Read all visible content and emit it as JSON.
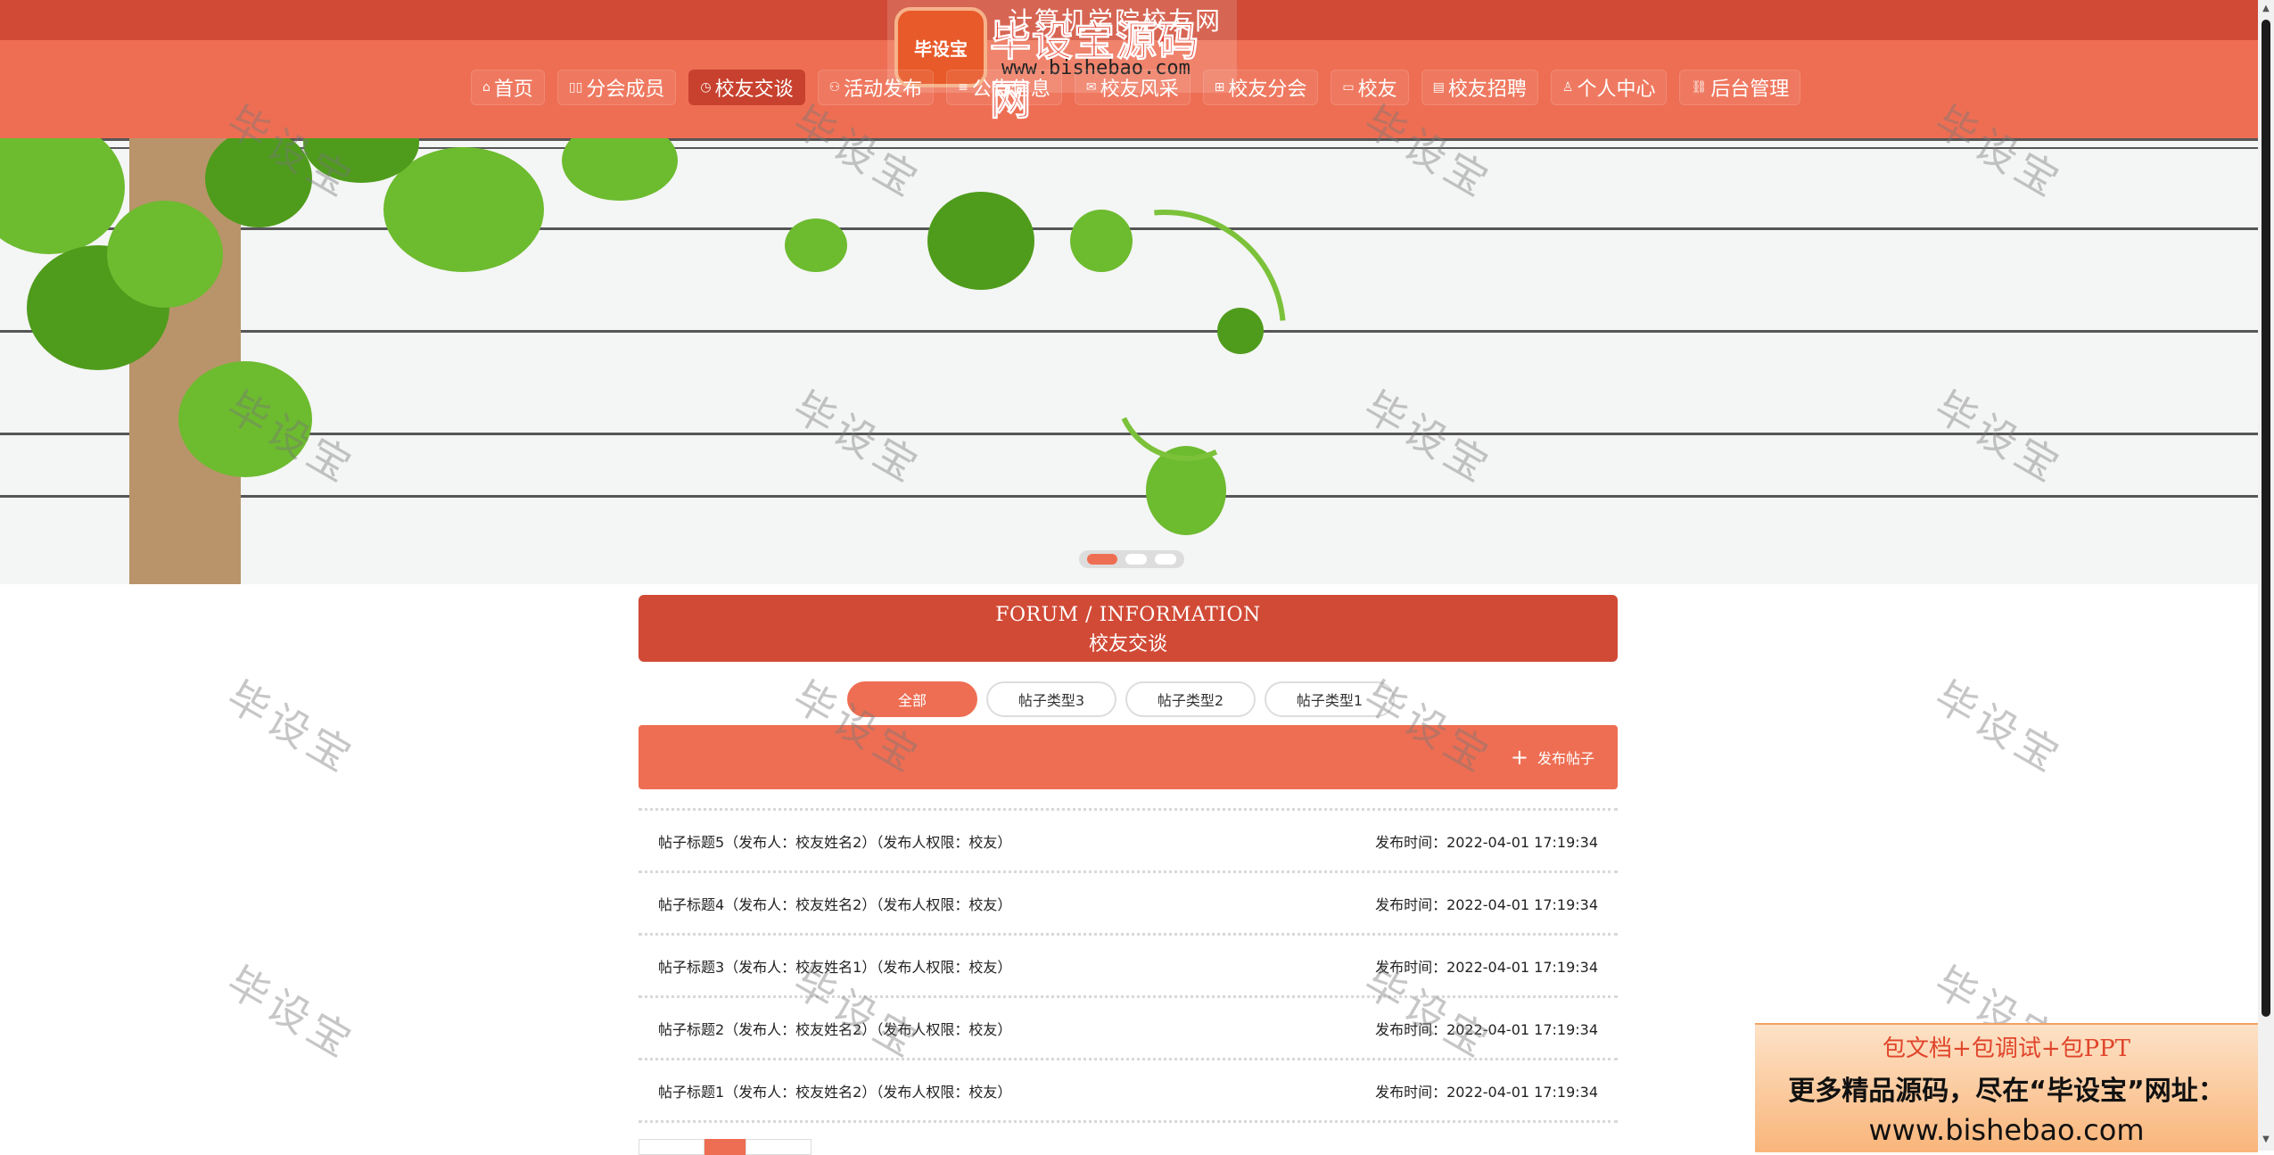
{
  "site": {
    "title": "计算机学院校友网"
  },
  "logo": {
    "badge": "毕设宝",
    "name": "毕设宝源码网",
    "url": "www.bishebao.com"
  },
  "nav": [
    {
      "label": "首页",
      "icon": "home-icon",
      "glyph": "⌂"
    },
    {
      "label": "分会成员",
      "icon": "members-icon",
      "glyph": "▯▯"
    },
    {
      "label": "校友交谈",
      "icon": "clock-icon",
      "glyph": "◷",
      "active": true
    },
    {
      "label": "活动发布",
      "icon": "activity-icon",
      "glyph": "⚇"
    },
    {
      "label": "公告信息",
      "icon": "notice-icon",
      "glyph": "≡"
    },
    {
      "label": "校友风采",
      "icon": "mail-icon",
      "glyph": "✉"
    },
    {
      "label": "校友分会",
      "icon": "grid-icon",
      "glyph": "⊞"
    },
    {
      "label": "校友",
      "icon": "user-card-icon",
      "glyph": "▭"
    },
    {
      "label": "校友招聘",
      "icon": "job-icon",
      "glyph": "▤"
    },
    {
      "label": "个人中心",
      "icon": "person-icon",
      "glyph": "♙"
    },
    {
      "label": "后台管理",
      "icon": "link-icon",
      "glyph": "⛓"
    }
  ],
  "section": {
    "title_en": "FORUM / INFORMATION",
    "title_cn": "校友交谈"
  },
  "tabs": [
    {
      "label": "全部",
      "active": true
    },
    {
      "label": "帖子类型3"
    },
    {
      "label": "帖子类型2"
    },
    {
      "label": "帖子类型1"
    }
  ],
  "actions": {
    "publish": "发布帖子"
  },
  "posts": [
    {
      "title": "帖子标题5（发布人：校友姓名2）（发布人权限：校友）",
      "time": "发布时间：2022-04-01 17:19:34"
    },
    {
      "title": "帖子标题4（发布人：校友姓名2）（发布人权限：校友）",
      "time": "发布时间：2022-04-01 17:19:34"
    },
    {
      "title": "帖子标题3（发布人：校友姓名1）（发布人权限：校友）",
      "time": "发布时间：2022-04-01 17:19:34"
    },
    {
      "title": "帖子标题2（发布人：校友姓名2）（发布人权限：校友）",
      "time": "发布时间：2022-04-01 17:19:34"
    },
    {
      "title": "帖子标题1（发布人：校友姓名2）（发布人权限：校友）",
      "time": "发布时间：2022-04-01 17:19:34"
    }
  ],
  "watermark": "毕设宝",
  "ad": {
    "line1": "包文档+包调试+包PPT",
    "line2": "更多精品源码，尽在“毕设宝”网址：",
    "line3": "www.bishebao.com"
  },
  "colors": {
    "topbar": "#d14a36",
    "navbar": "#ee6e53",
    "accent": "#ee6e53"
  }
}
